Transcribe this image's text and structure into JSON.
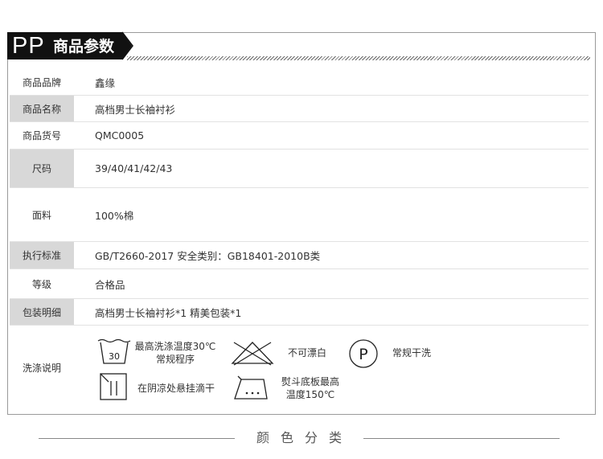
{
  "header": {
    "badge": "PP",
    "title": "商品参数"
  },
  "params": [
    {
      "label": "商品品牌",
      "value": "鑫缘"
    },
    {
      "label": "商品名称",
      "value": "高档男士长袖衬衫"
    },
    {
      "label": "商品货号",
      "value": "QMC0005"
    },
    {
      "label": "尺码",
      "value": "39/40/41/42/43"
    },
    {
      "label": "面料",
      "value": "100%棉"
    },
    {
      "label": "执行标准",
      "value": "GB/T2660-2017  安全类别：GB18401-2010B类"
    },
    {
      "label": "等级",
      "value": "合格品"
    },
    {
      "label": "包装明细",
      "value": "高档男士长袖衬衫*1   精美包装*1"
    }
  ],
  "washing": {
    "label": "洗涤说明",
    "items": [
      {
        "icon": "wash-tub-30-icon",
        "number": "30",
        "line1": "最高洗涤温度30℃",
        "line2": "常规程序"
      },
      {
        "icon": "no-bleach-icon",
        "line1": "不可漂白"
      },
      {
        "icon": "dry-clean-p-icon",
        "letter": "P",
        "line1": "常规干洗"
      },
      {
        "icon": "line-dry-shade-icon",
        "line1": "在阴凉处悬挂滴干"
      },
      {
        "icon": "iron-150-icon",
        "line1": "熨斗底板最高",
        "line2": "温度150℃"
      }
    ]
  },
  "footer": {
    "title": "颜色分类"
  }
}
